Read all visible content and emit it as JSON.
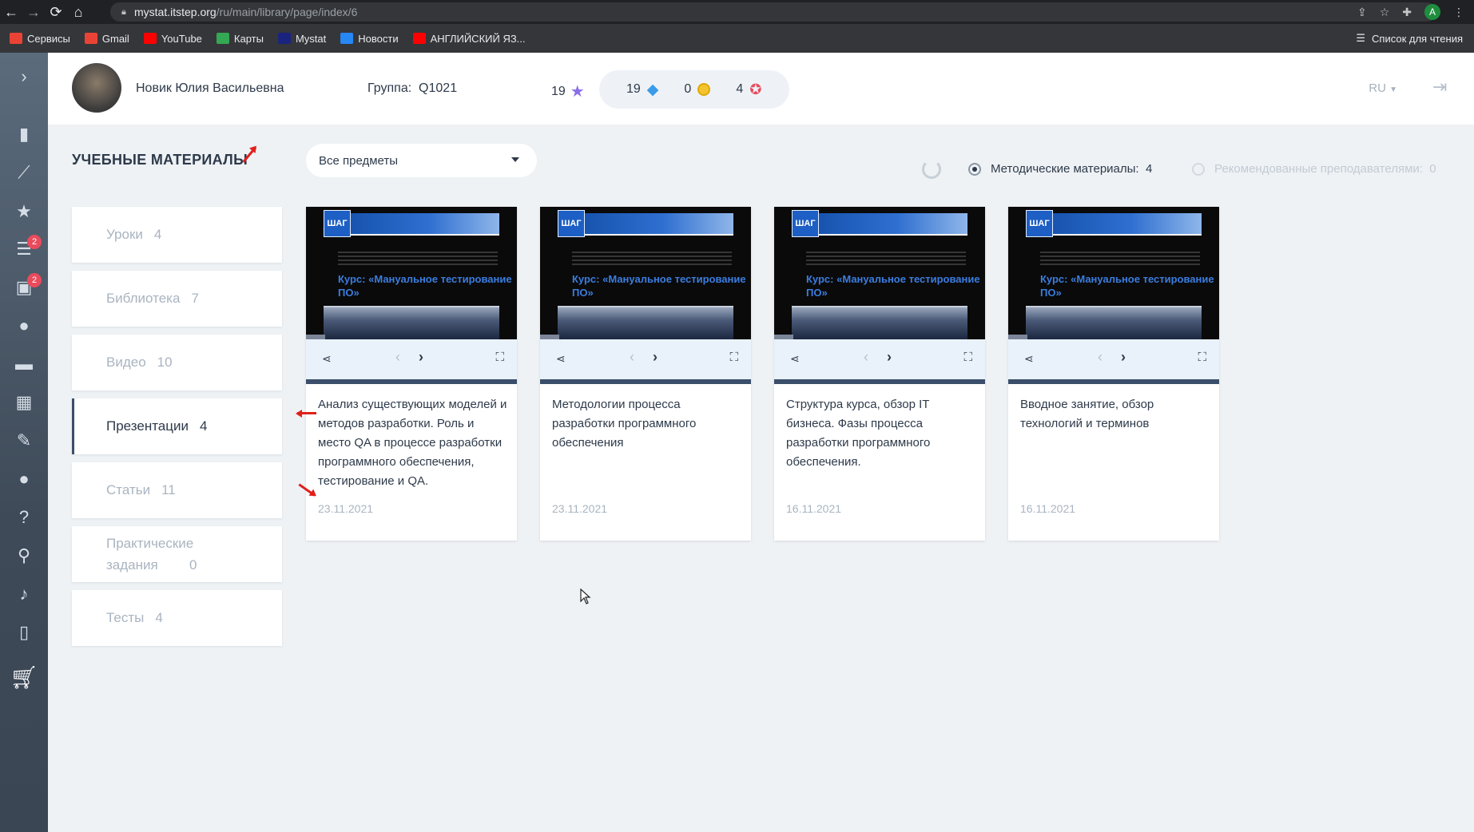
{
  "browser": {
    "url_host": "mystat.itstep.org",
    "url_path": "/ru/main/library/page/index/6",
    "profile_initial": "A",
    "bookmarks": [
      {
        "label": "Сервисы",
        "icon": "apps-grid-icon",
        "color": "#ea4335"
      },
      {
        "label": "Gmail",
        "icon": "gmail-icon",
        "color": "#ea4335"
      },
      {
        "label": "YouTube",
        "icon": "youtube-icon",
        "color": "#ff0000"
      },
      {
        "label": "Карты",
        "icon": "maps-icon",
        "color": "#34a853"
      },
      {
        "label": "Mystat",
        "icon": "mystat-icon",
        "color": "#1a237e"
      },
      {
        "label": "Новости",
        "icon": "vk-icon",
        "color": "#2787f5"
      },
      {
        "label": "АНГЛИЙСКИЙ ЯЗ...",
        "icon": "youtube-icon",
        "color": "#ff0000"
      }
    ],
    "reading_list": "Список для чтения"
  },
  "header": {
    "user_name": "Новик Юлия Васильевна",
    "group_label": "Группа:",
    "group_value": "Q1021",
    "stars": "19",
    "gems": "19",
    "coins": "0",
    "badges": "4",
    "language": "RU"
  },
  "sidebar": {
    "items": [
      {
        "icon": "chevron-right-icon"
      },
      {
        "icon": "bar-chart-icon"
      },
      {
        "icon": "line-chart-icon"
      },
      {
        "icon": "star-icon"
      },
      {
        "icon": "list-icon",
        "badge": "2"
      },
      {
        "icon": "homework-icon",
        "badge": "2"
      },
      {
        "icon": "chat-icon"
      },
      {
        "icon": "card-icon"
      },
      {
        "icon": "calendar-icon"
      },
      {
        "icon": "pen-icon"
      },
      {
        "icon": "user-icon"
      },
      {
        "icon": "help-icon"
      },
      {
        "icon": "location-icon"
      },
      {
        "icon": "microphone-icon"
      },
      {
        "icon": "book-icon"
      },
      {
        "icon": "cart-icon"
      }
    ]
  },
  "main": {
    "title": "УЧЕБНЫЕ МАТЕРИАЛЫ",
    "subject_select": "Все предметы",
    "filter_methodical": "Методические материалы:",
    "filter_methodical_count": "4",
    "filter_recommended": "Рекомендованные преподавателями:",
    "filter_recommended_count": "0"
  },
  "categories": [
    {
      "label": "Уроки",
      "count": "4",
      "active": false
    },
    {
      "label": "Библиотека",
      "count": "7",
      "active": false
    },
    {
      "label": "Видео",
      "count": "10",
      "active": false
    },
    {
      "label": "Презентации",
      "count": "4",
      "active": true
    },
    {
      "label": "Статьи",
      "count": "11",
      "active": false
    },
    {
      "label": "Практические задания",
      "count": "0",
      "active": false
    },
    {
      "label": "Тесты",
      "count": "4",
      "active": false
    }
  ],
  "cards": [
    {
      "title": "Анализ существующих моделей и методов разработки. Роль и место QA в процессе разработки программного обеспечения, тестирование и QA.",
      "date": "23.11.2021",
      "course": "Курс: «Мануальное тестирование ПО»"
    },
    {
      "title": "Методологии процесса разработки программного обеспечения",
      "date": "23.11.2021",
      "course": "Курс: «Мануальное тестирование ПО»"
    },
    {
      "title": "Структура курса, обзор IT бизнеса. Фазы процесса разработки программного обеспечения.",
      "date": "16.11.2021",
      "course": "Курс: «Мануальное тестирование ПО»"
    },
    {
      "title": "Вводное занятие, обзор технологий и терминов",
      "date": "16.11.2021",
      "course": "Курс: «Мануальное тестирование ПО»"
    }
  ],
  "colors": {
    "accent": "#3b4f6b",
    "annotation_arrow": "#e0201b",
    "badge": "#e94b5c"
  }
}
